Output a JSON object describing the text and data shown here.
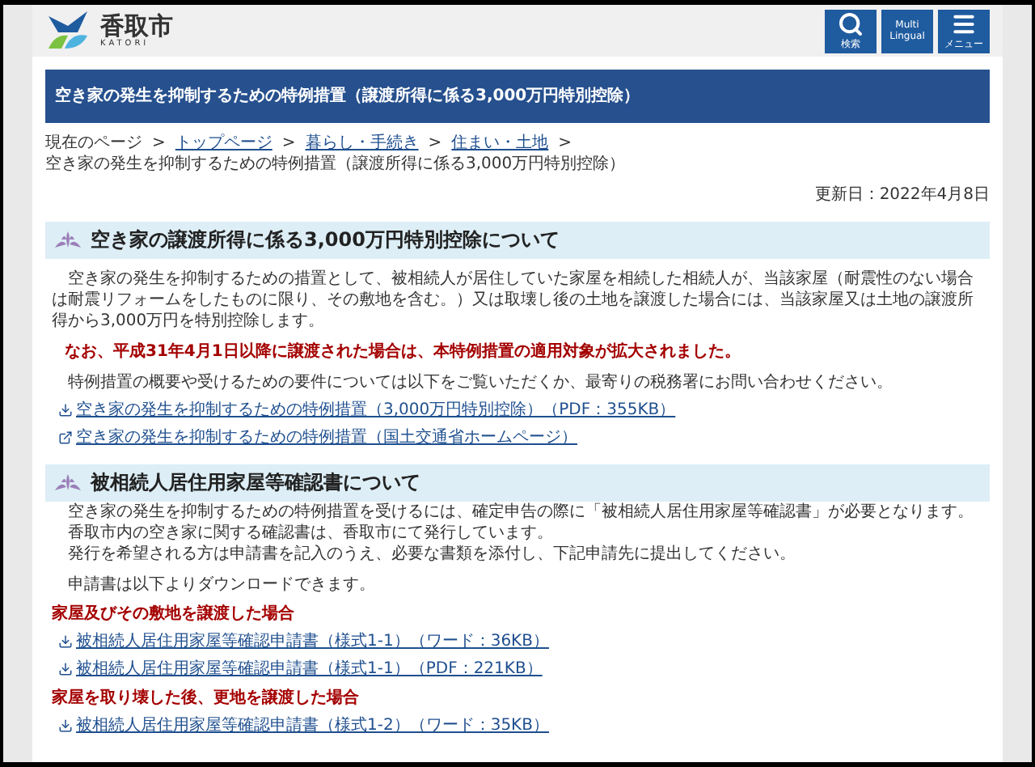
{
  "header": {
    "logo_text": "香取市",
    "logo_subtext": "KATORI",
    "buttons": [
      {
        "kind": "search",
        "label": "検索"
      },
      {
        "kind": "language",
        "label": "Multi Lingual"
      },
      {
        "kind": "menu",
        "label": "メニュー"
      }
    ]
  },
  "page_title": "空き家の発生を抑制するための特例措置（譲渡所得に係る3,000万円特別控除）",
  "breadcrumb": {
    "label": "現在のページ",
    "links": [
      {
        "separator": ">",
        "text": "トップページ"
      },
      {
        "separator": ">",
        "text": "暮らし・手続き"
      },
      {
        "separator": ">",
        "text": "住まい・土地"
      }
    ],
    "end_separator": ">",
    "current": "空き家の発生を抑制するための特例措置（譲渡所得に係る3,000万円特別控除）"
  },
  "updated": "更新日：2022年4月8日",
  "sections": [
    {
      "heading": "空き家の譲渡所得に係る3,000万円特別控除について",
      "blocks": [
        {
          "kind": "paragraph",
          "text": "空き家の発生を抑制するための措置として、被相続人が居住していた家屋を相続した相続人が、当該家屋（耐震性のない場合は耐震リフォームをしたものに限り、その敷地を含む。）又は取壊し後の土地を譲渡した場合には、当該家屋又は土地の譲渡所得から3,000万円を特別控除します。"
        },
        {
          "kind": "notice",
          "text": "なお、平成31年4月1日以降に譲渡された場合は、本特例措置の適用対象が拡大されました。"
        },
        {
          "kind": "paragraph",
          "text": "特例措置の概要や受けるための要件については以下をご覧いただくか、最寄りの税務署にお問い合わせください。"
        },
        {
          "kind": "download_link",
          "text": "空き家の発生を抑制するための特例措置（3,000万円特別控除）（PDF：355KB）"
        },
        {
          "kind": "external_link",
          "text": "空き家の発生を抑制するための特例措置（国土交通省ホームページ）"
        }
      ]
    },
    {
      "heading": "被相続人居住用家屋等確認書について",
      "blocks": [
        {
          "kind": "line",
          "text": "空き家の発生を抑制するための特例措置を受けるには、確定申告の際に「被相続人居住用家屋等確認書」が必要となります。"
        },
        {
          "kind": "line",
          "text": "香取市内の空き家に関する確認書は、香取市にて発行しています。"
        },
        {
          "kind": "line",
          "text": "発行を希望される方は申請書を記入のうえ、必要な書類を添付し、下記申請先に提出してください。"
        },
        {
          "kind": "paragraph",
          "text": "申請書は以下よりダウンロードできます。"
        },
        {
          "kind": "subheading",
          "text": "家屋及びその敷地を譲渡した場合"
        },
        {
          "kind": "download_link",
          "text": "被相続人居住用家屋等確認申請書（様式1-1）（ワード：36KB）"
        },
        {
          "kind": "download_link",
          "text": "被相続人居住用家屋等確認申請書（様式1-1）（PDF：221KB）"
        },
        {
          "kind": "subheading",
          "text": "家屋を取り壊した後、更地を譲渡した場合"
        },
        {
          "kind": "download_link",
          "text": "被相続人居住用家屋等確認申請書（様式1-2）（ワード：35KB）"
        }
      ]
    }
  ]
}
